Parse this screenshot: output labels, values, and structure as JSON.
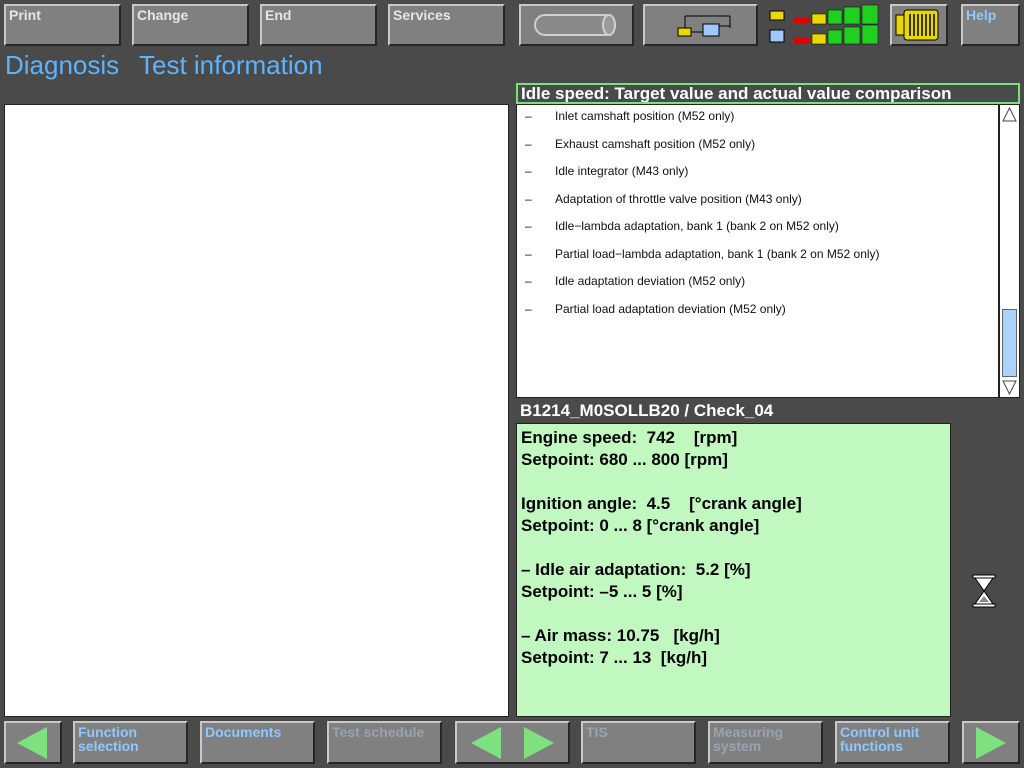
{
  "toolbar": {
    "print": "Print",
    "change": "Change",
    "end": "End",
    "services": "Services",
    "help": "Help"
  },
  "header": {
    "diagnosis": "Diagnosis",
    "test_information": "Test information"
  },
  "info_panel": {
    "title": "Idle speed: Target value and actual value comparison",
    "items": [
      {
        "dash": "–",
        "text": "Inlet camshaft position (M52 only)"
      },
      {
        "dash": "–",
        "text": "Exhaust camshaft position (M52 only)"
      },
      {
        "dash": "–",
        "text": "Idle integrator (M43 only)"
      },
      {
        "dash": "–",
        "text": "Adaptation of throttle valve position (M43 only)"
      },
      {
        "dash": "–",
        "text": "Idle−lambda adaptation, bank 1 (bank 2 on M52 only)"
      },
      {
        "dash": "–",
        "text": "Partial load−lambda adaptation, bank 1 (bank 2 on M52 only)"
      },
      {
        "dash": "–",
        "text": "Idle adaptation deviation (M52 only)"
      },
      {
        "dash": "–",
        "text": "Partial load adaptation deviation (M52 only)"
      }
    ]
  },
  "measurement": {
    "title": "B1214_M0SOLLB20 / Check_04",
    "lines": [
      "Engine speed:  742    [rpm]",
      "Setpoint: 680 ... 800 [rpm]",
      "",
      "Ignition angle:  4.5    [°crank angle]",
      "Setpoint: 0 ... 8 [°crank angle]",
      "",
      "– Idle air adaptation:  5.2 [%]",
      "Setpoint: –5 ... 5 [%]",
      "",
      "– Air mass: 10.75   [kg/h]",
      "Setpoint: 7 ... 13  [kg/h]"
    ]
  },
  "bottom_bar": {
    "function_selection": "Function selection",
    "documents": "Documents",
    "test_schedule": "Test schedule",
    "tis": "TIS",
    "measuring_system": "Measuring system",
    "control_unit_functions": "Control unit functions"
  },
  "colors": {
    "background": "#4a4a4a",
    "button": "#808080",
    "title_blue": "#5cb4ff",
    "info_green": "#c0f8c0",
    "arrow_green": "#7ee07e"
  }
}
